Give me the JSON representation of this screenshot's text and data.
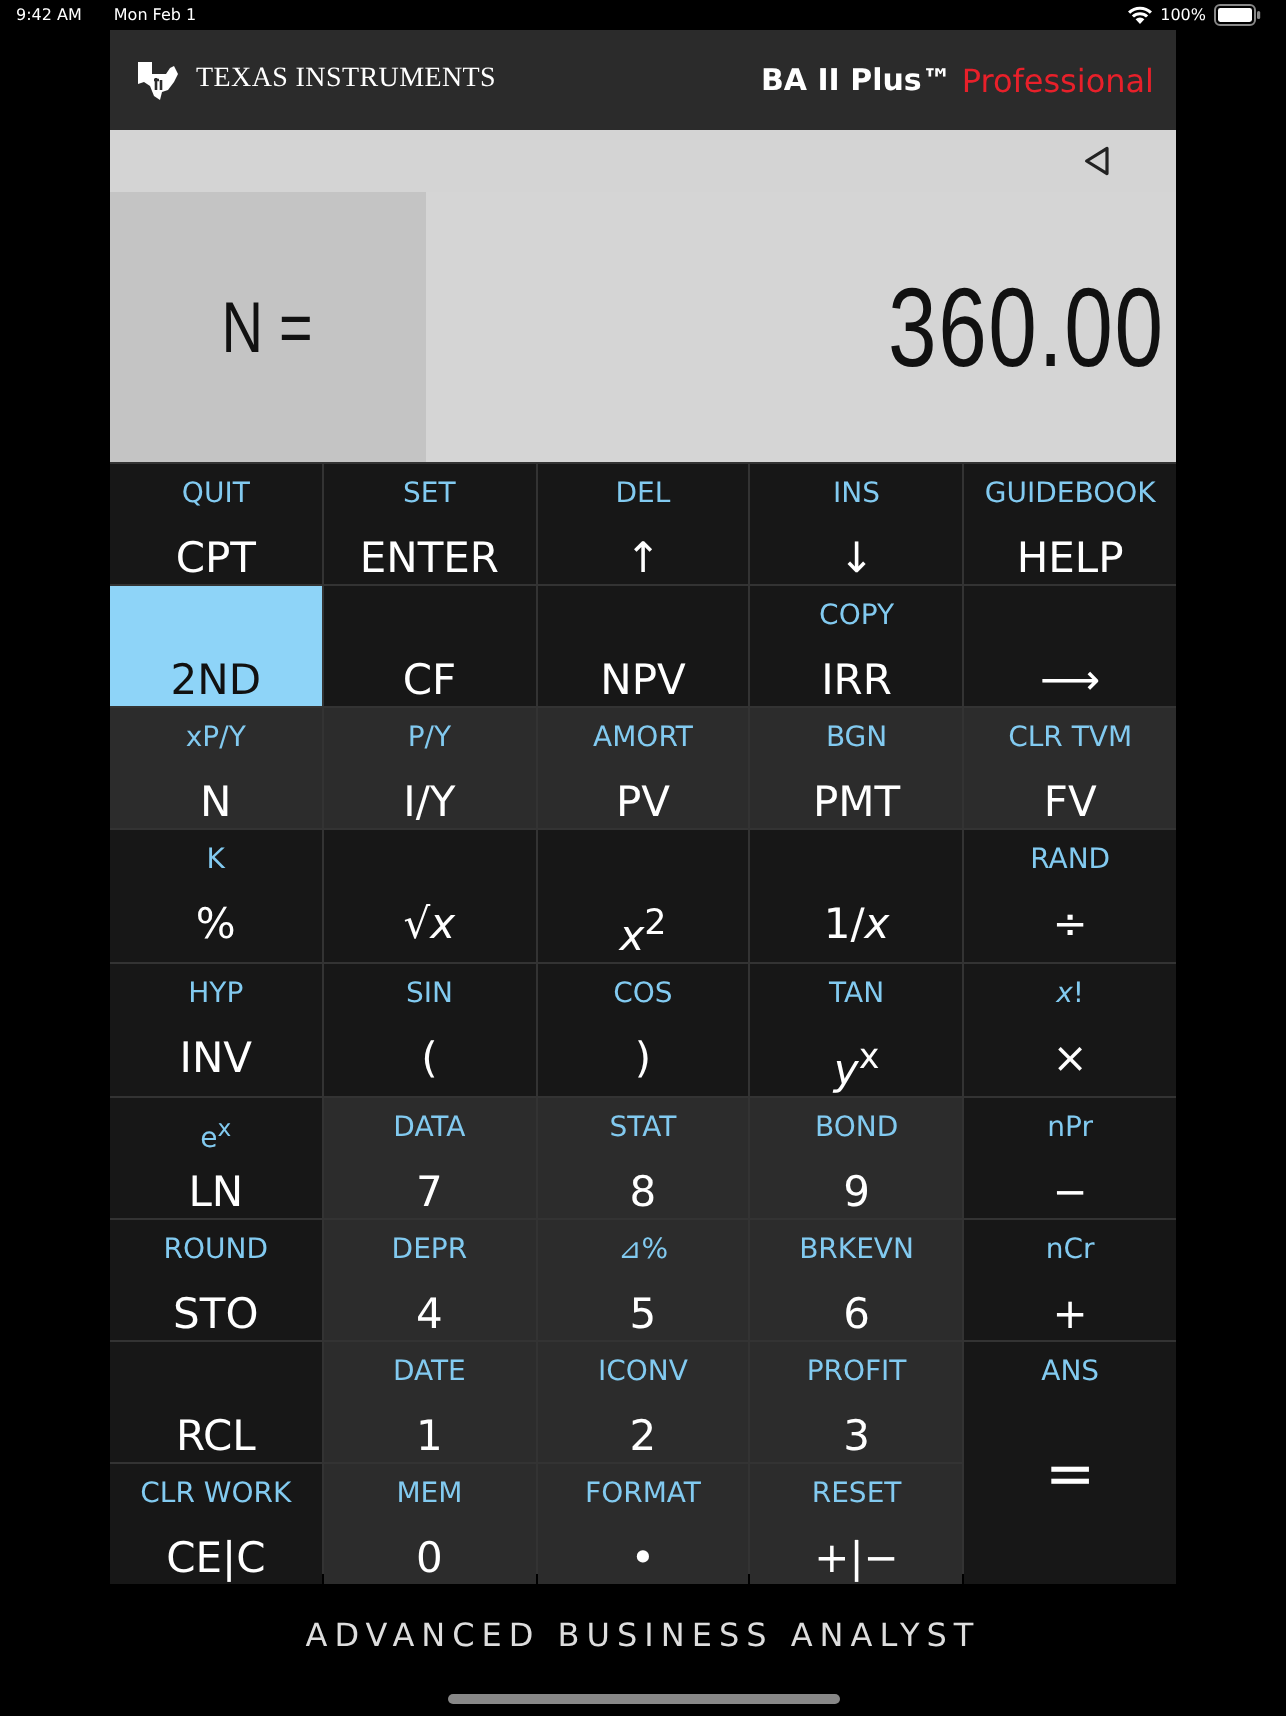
{
  "status_bar": {
    "time": "9:42 AM",
    "date": "Mon Feb 1",
    "battery": "100%"
  },
  "header": {
    "brand": "TEXAS INSTRUMENTS",
    "model": "BA II Plus™",
    "edition": "Professional"
  },
  "display": {
    "variable": "N =",
    "value": "360.00"
  },
  "keys": [
    {
      "second": "QUIT",
      "label": "CPT",
      "kind": "dark",
      "active": false
    },
    {
      "second": "SET",
      "label": "ENTER",
      "kind": "dark",
      "active": false
    },
    {
      "second": "DEL",
      "label": "↑",
      "kind": "dark",
      "active": false
    },
    {
      "second": "INS",
      "label": "↓",
      "kind": "dark",
      "active": false
    },
    {
      "second": "GUIDEBOOK",
      "label": "HELP",
      "kind": "dark",
      "active": false
    },
    {
      "label": "2ND",
      "kind": "dark",
      "active": true
    },
    {
      "label": "CF",
      "kind": "dark",
      "active": false
    },
    {
      "label": "NPV",
      "kind": "dark",
      "active": false
    },
    {
      "second": "COPY",
      "label": "IRR",
      "kind": "dark",
      "active": false
    },
    {
      "label": "⟶",
      "kind": "dark",
      "active": false
    },
    {
      "second": "xP/Y",
      "label": "N",
      "kind": "gray",
      "active": false
    },
    {
      "second": "P/Y",
      "label": "I/Y",
      "kind": "gray",
      "active": false
    },
    {
      "second": "AMORT",
      "label": "PV",
      "kind": "gray",
      "active": false
    },
    {
      "second": "BGN",
      "label": "PMT",
      "kind": "gray",
      "active": false
    },
    {
      "second": "CLR TVM",
      "label": "FV",
      "kind": "gray",
      "active": false
    },
    {
      "second": "K",
      "label": "%",
      "kind": "dark",
      "active": false
    },
    {
      "label": "√*x*",
      "kind": "dark",
      "active": false
    },
    {
      "label": "*x*$^{2}$",
      "kind": "dark",
      "active": false
    },
    {
      "label": "1/*x*",
      "kind": "dark",
      "active": false
    },
    {
      "second": "RAND",
      "label": "÷",
      "kind": "dark",
      "active": false
    },
    {
      "second": "HYP",
      "label": "INV",
      "kind": "dark",
      "active": false
    },
    {
      "second": "SIN",
      "label": "(",
      "kind": "dark",
      "active": false
    },
    {
      "second": "COS",
      "label": ")",
      "kind": "dark",
      "active": false
    },
    {
      "second": "TAN",
      "label": "*y*$^{x}$",
      "kind": "dark",
      "active": false
    },
    {
      "second": "*x*!",
      "label": "×",
      "kind": "dark",
      "active": false
    },
    {
      "second": "e$^{x}$",
      "label": "LN",
      "kind": "dark",
      "active": false
    },
    {
      "second": "DATA",
      "label": "7",
      "kind": "gray",
      "active": false
    },
    {
      "second": "STAT",
      "label": "8",
      "kind": "gray",
      "active": false
    },
    {
      "second": "BOND",
      "label": "9",
      "kind": "gray",
      "active": false
    },
    {
      "second": "nPr",
      "label": "−",
      "kind": "dark",
      "active": false
    },
    {
      "second": "ROUND",
      "label": "STO",
      "kind": "dark",
      "active": false
    },
    {
      "second": "DEPR",
      "label": "4",
      "kind": "gray",
      "active": false
    },
    {
      "second": "⊿%",
      "label": "5",
      "kind": "gray",
      "active": false
    },
    {
      "second": "BRKEVN",
      "label": "6",
      "kind": "gray",
      "active": false
    },
    {
      "second": "nCr",
      "label": "+",
      "kind": "dark",
      "active": false
    },
    {
      "label": "RCL",
      "kind": "dark",
      "active": false
    },
    {
      "second": "DATE",
      "label": "1",
      "kind": "gray",
      "active": false
    },
    {
      "second": "ICONV",
      "label": "2",
      "kind": "gray",
      "active": false
    },
    {
      "second": "PROFIT",
      "label": "3",
      "kind": "gray",
      "active": false
    },
    {
      "second": "ANS",
      "label": "=",
      "kind": "dark",
      "active": false,
      "tall": true
    },
    {
      "second": "CLR WORK",
      "label": "CE|C",
      "kind": "dark",
      "active": false
    },
    {
      "second": "MEM",
      "label": "0",
      "kind": "gray",
      "active": false
    },
    {
      "second": "FORMAT",
      "label": "•",
      "kind": "gray",
      "active": false
    },
    {
      "second": "RESET",
      "label": "+|−",
      "kind": "gray",
      "active": false
    }
  ],
  "footer": {
    "tagline": "ADVANCED BUSINESS ANALYST"
  }
}
